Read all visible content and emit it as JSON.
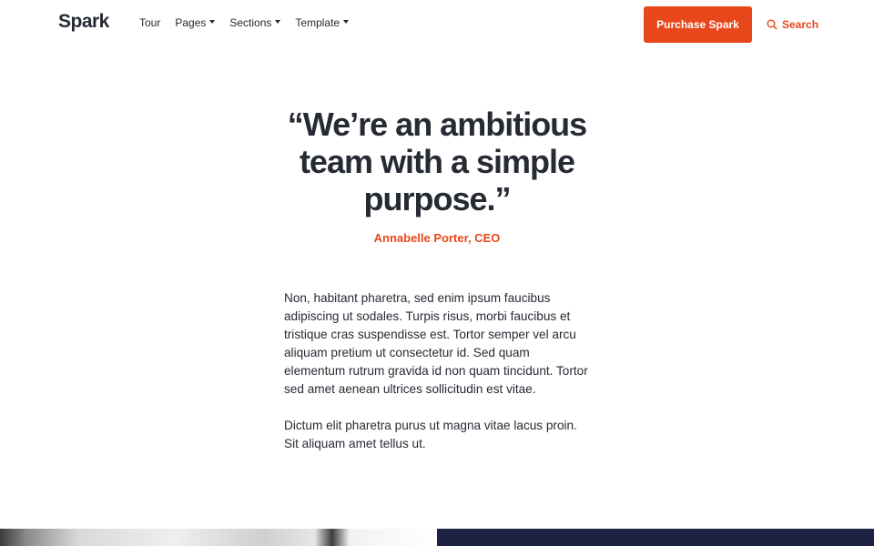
{
  "nav": {
    "logo": "Spark",
    "links": [
      {
        "label": "Tour",
        "has_dropdown": false
      },
      {
        "label": "Pages",
        "has_dropdown": true
      },
      {
        "label": "Sections",
        "has_dropdown": true
      },
      {
        "label": "Template",
        "has_dropdown": true
      }
    ],
    "purchase_label": "Purchase Spark",
    "search_label": "Search",
    "search_icon": "search-icon"
  },
  "quote": {
    "text": "“We’re an ambitious team with a simple purpose.”",
    "author": "Annabelle Porter, CEO"
  },
  "body": {
    "paragraphs": [
      "Non, habitant pharetra, sed enim ipsum faucibus adipiscing ut sodales. Turpis risus, morbi faucibus et tristique cras suspendisse est. Tortor semper vel arcu aliquam pretium ut consectetur id. Sed quam elementum rutrum gravida id non quam tincidunt. Tortor sed amet aenean ultrices sollicitudin est vitae.",
      "Dictum elit pharetra purus ut magna vitae lacus proin. Sit aliquam amet tellus ut."
    ]
  },
  "colors": {
    "accent": "#e8471c",
    "text": "#262a33",
    "dark_panel": "#1c2342"
  }
}
